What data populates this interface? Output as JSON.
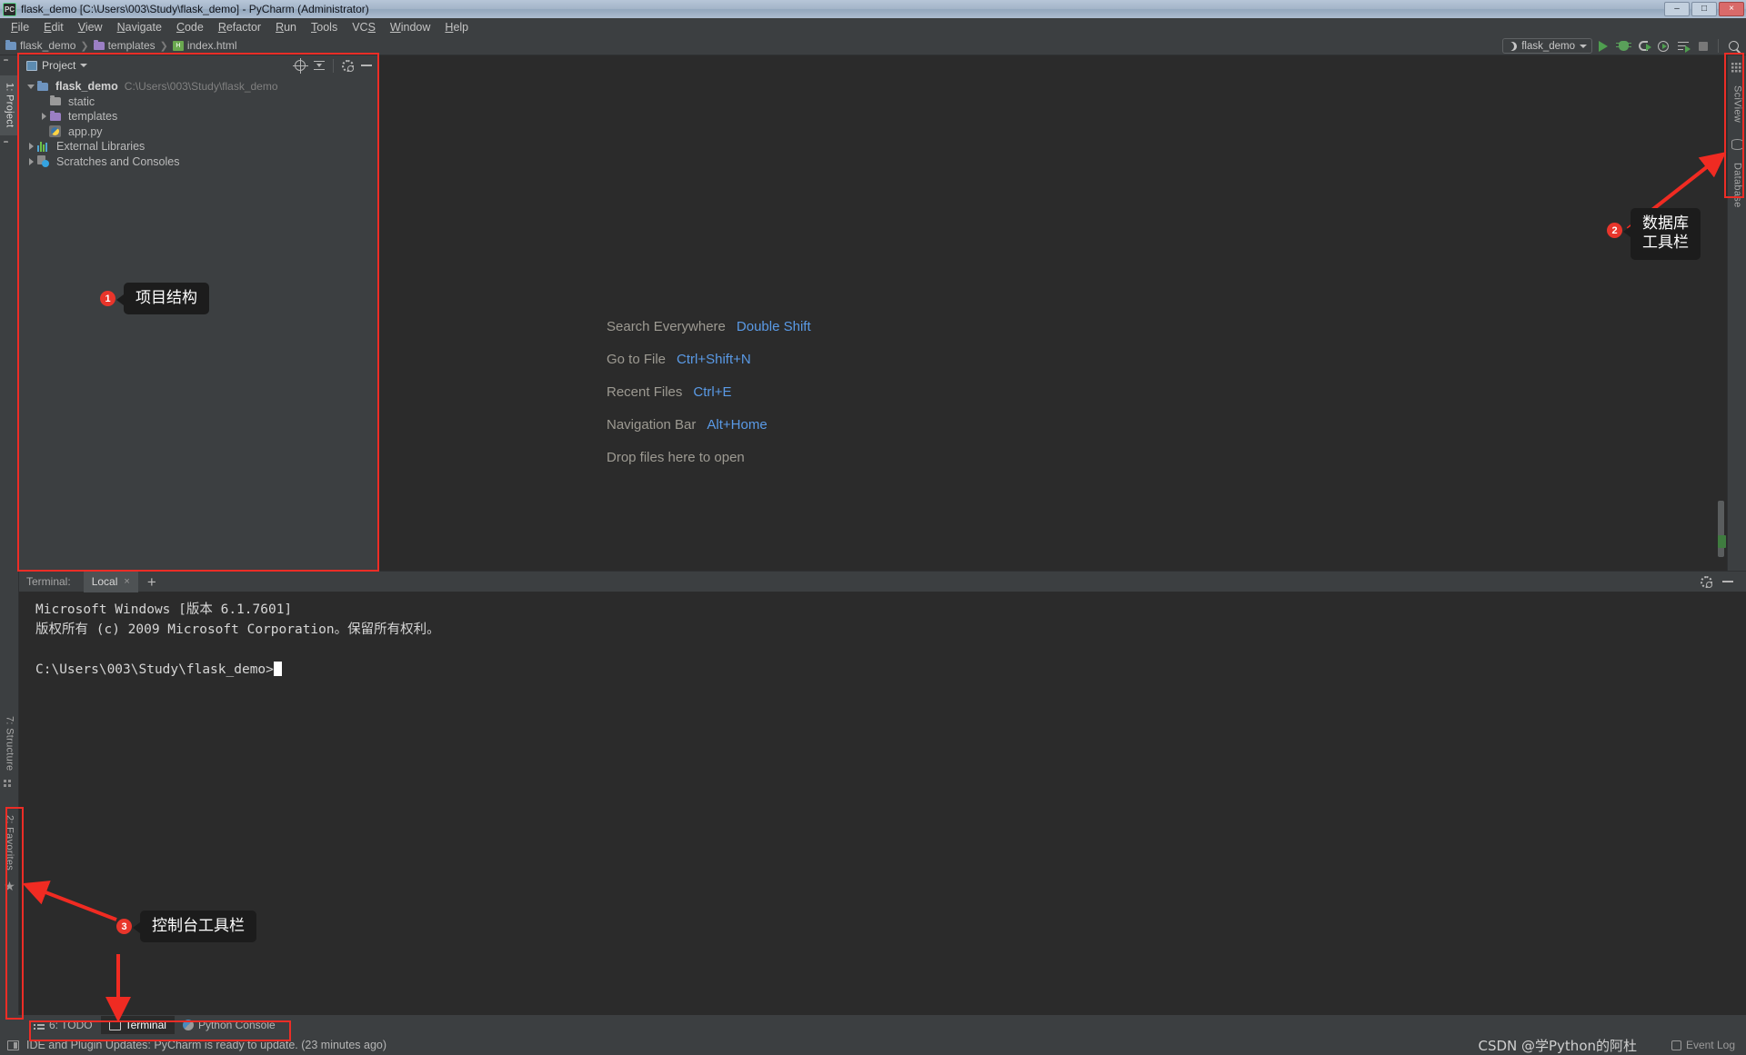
{
  "window": {
    "title": "flask_demo [C:\\Users\\003\\Study\\flask_demo] - PyCharm (Administrator)",
    "app_icon": "pycharm-icon",
    "minimize": "–",
    "maximize": "□",
    "close": "×"
  },
  "menu": [
    {
      "label": "File"
    },
    {
      "label": "Edit"
    },
    {
      "label": "View"
    },
    {
      "label": "Navigate"
    },
    {
      "label": "Code"
    },
    {
      "label": "Refactor"
    },
    {
      "label": "Run"
    },
    {
      "label": "Tools"
    },
    {
      "label": "VCS"
    },
    {
      "label": "Window"
    },
    {
      "label": "Help"
    }
  ],
  "breadcrumb": [
    {
      "label": "flask_demo",
      "icon": "folder-blue-icon"
    },
    {
      "label": "templates",
      "icon": "folder-purple-icon"
    },
    {
      "label": "index.html",
      "icon": "html-file-icon"
    }
  ],
  "run_toolbar": {
    "config_name": "flask_demo",
    "icons": [
      "run-icon",
      "debug-icon",
      "coverage-icon",
      "profile-icon",
      "run-with-console-icon",
      "stop-icon",
      "search-icon"
    ]
  },
  "left_rail": {
    "tabs": [
      {
        "label": "1: Project",
        "icon": "folder-icon",
        "selected": true
      },
      {
        "label": "7: Structure",
        "icon": "structure-icon",
        "selected": false
      },
      {
        "label": "2: Favorites",
        "icon": "star-icon",
        "selected": false
      }
    ]
  },
  "project_panel": {
    "title": "Project",
    "header_icons": [
      "locate-target-icon",
      "collapse-all-icon",
      "settings-gear-icon",
      "hide-panel-icon"
    ],
    "tree": [
      {
        "label": "flask_demo",
        "path": "C:\\Users\\003\\Study\\flask_demo",
        "icon": "folder-blue-icon",
        "expanded": true,
        "depth": 0,
        "bold": true
      },
      {
        "label": "static",
        "path": "",
        "icon": "folder-gray-icon",
        "expanded": null,
        "depth": 1,
        "bold": false
      },
      {
        "label": "templates",
        "path": "",
        "icon": "folder-purple-icon",
        "expanded": false,
        "depth": 1,
        "bold": false
      },
      {
        "label": "app.py",
        "path": "",
        "icon": "python-file-icon",
        "expanded": null,
        "depth": 1,
        "bold": false
      },
      {
        "label": "External Libraries",
        "path": "",
        "icon": "libraries-icon",
        "expanded": false,
        "depth": 0,
        "bold": false
      },
      {
        "label": "Scratches and Consoles",
        "path": "",
        "icon": "scratches-icon",
        "expanded": false,
        "depth": 0,
        "bold": false
      }
    ]
  },
  "editor": {
    "hints": [
      {
        "label": "Search Everywhere",
        "key": "Double Shift"
      },
      {
        "label": "Go to File",
        "key": "Ctrl+Shift+N"
      },
      {
        "label": "Recent Files",
        "key": "Ctrl+E"
      },
      {
        "label": "Navigation Bar",
        "key": "Alt+Home"
      }
    ],
    "drop_text": "Drop files here to open"
  },
  "right_rail": {
    "tabs": [
      {
        "label": "SciView",
        "icon": "grid-icon"
      },
      {
        "label": "Database",
        "icon": "database-icon"
      }
    ]
  },
  "terminal": {
    "label": "Terminal:",
    "tab": "Local",
    "tab_close": "×",
    "add_tab": "+",
    "header_icons": [
      "settings-gear-icon",
      "hide-panel-icon"
    ],
    "lines": [
      "Microsoft Windows [版本 6.1.7601]",
      "版权所有 (c) 2009 Microsoft Corporation。保留所有权利。",
      "",
      "C:\\Users\\003\\Study\\flask_demo>"
    ]
  },
  "bottom_buttons": [
    {
      "label": "6: TODO",
      "icon": "todo-icon",
      "selected": false
    },
    {
      "label": "Terminal",
      "icon": "terminal-icon",
      "selected": true
    },
    {
      "label": "Python Console",
      "icon": "python-console-icon",
      "selected": false
    }
  ],
  "status_bar": {
    "message": "IDE and Plugin Updates: PyCharm is ready to update. (23 minutes ago)",
    "event_log": "Event Log",
    "watermark": "CSDN @学Python的阿杜"
  },
  "annotations": [
    {
      "number": "1",
      "text": "项目结构"
    },
    {
      "number": "2",
      "text": "数据库\n工具栏"
    },
    {
      "number": "3",
      "text": "控制台工具栏"
    }
  ],
  "colors": {
    "accent_red": "#ec2d26",
    "badge_red": "#e8352b",
    "link_blue": "#5a9ae6",
    "panel_bg": "#3c3f41",
    "editor_bg": "#2b2b2b"
  }
}
